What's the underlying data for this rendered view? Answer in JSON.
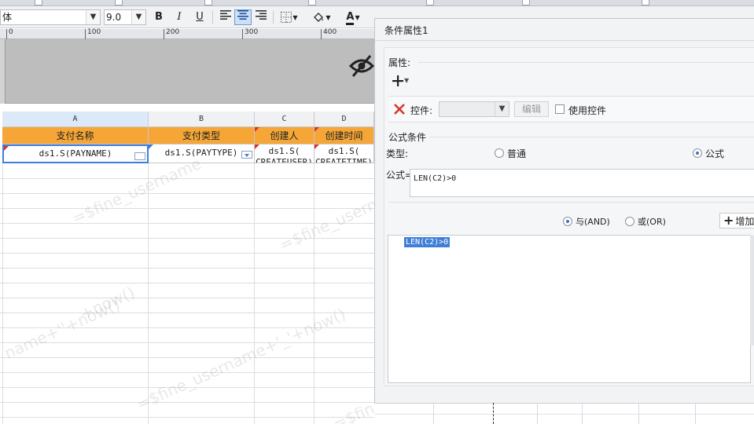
{
  "toolbar": {
    "font_name": "体",
    "font_size": "9.0",
    "bold": "B",
    "italic": "I",
    "underline": "U",
    "font_color_letter": "A"
  },
  "ruler": {
    "marks": [
      "0",
      "100",
      "200",
      "300",
      "400"
    ]
  },
  "grid": {
    "columns": [
      "A",
      "B",
      "C",
      "D"
    ],
    "headers": [
      "支付名称",
      "支付类型",
      "创建人",
      "创建时间"
    ],
    "row1": [
      "ds1.S(PAYNAME)",
      "ds1.S(PAYTYPE)",
      "ds1.S(",
      "ds1.S("
    ],
    "row1_overflow": [
      "CREATEUSER)",
      "CREATETIME)"
    ],
    "watermarks": [
      "=$fine_username",
      "=$fine_username",
      "+now()",
      "name+''+now()",
      "=$fine_username+'_'+now()",
      "=$fine_user"
    ]
  },
  "dialog": {
    "title": "条件属性1",
    "attributes_label": "属性:",
    "control_label": "控件:",
    "edit_button": "编辑",
    "use_control_label": "使用控件",
    "formula_condition_label": "公式条件",
    "type_label": "类型:",
    "type_normal": "普通",
    "type_formula": "公式",
    "formula_label": "公式=",
    "formula_value": "LEN(C2)>0",
    "and_label": "与(AND)",
    "or_label": "或(OR)",
    "add_button": "增加",
    "condition_list": [
      "LEN(C2)>0"
    ]
  },
  "colors": {
    "header_orange": "#f5a637",
    "selection_blue": "#3f7fd8",
    "banner_gray": "#bdbdbd",
    "error_red": "#d9342b"
  },
  "icons": [
    "plus-icon",
    "x-icon",
    "eye-slash-icon",
    "align-left-icon",
    "align-center-icon",
    "align-right-icon",
    "border-icon",
    "fill-color-icon",
    "font-color-icon",
    "chevron-down-icon"
  ]
}
